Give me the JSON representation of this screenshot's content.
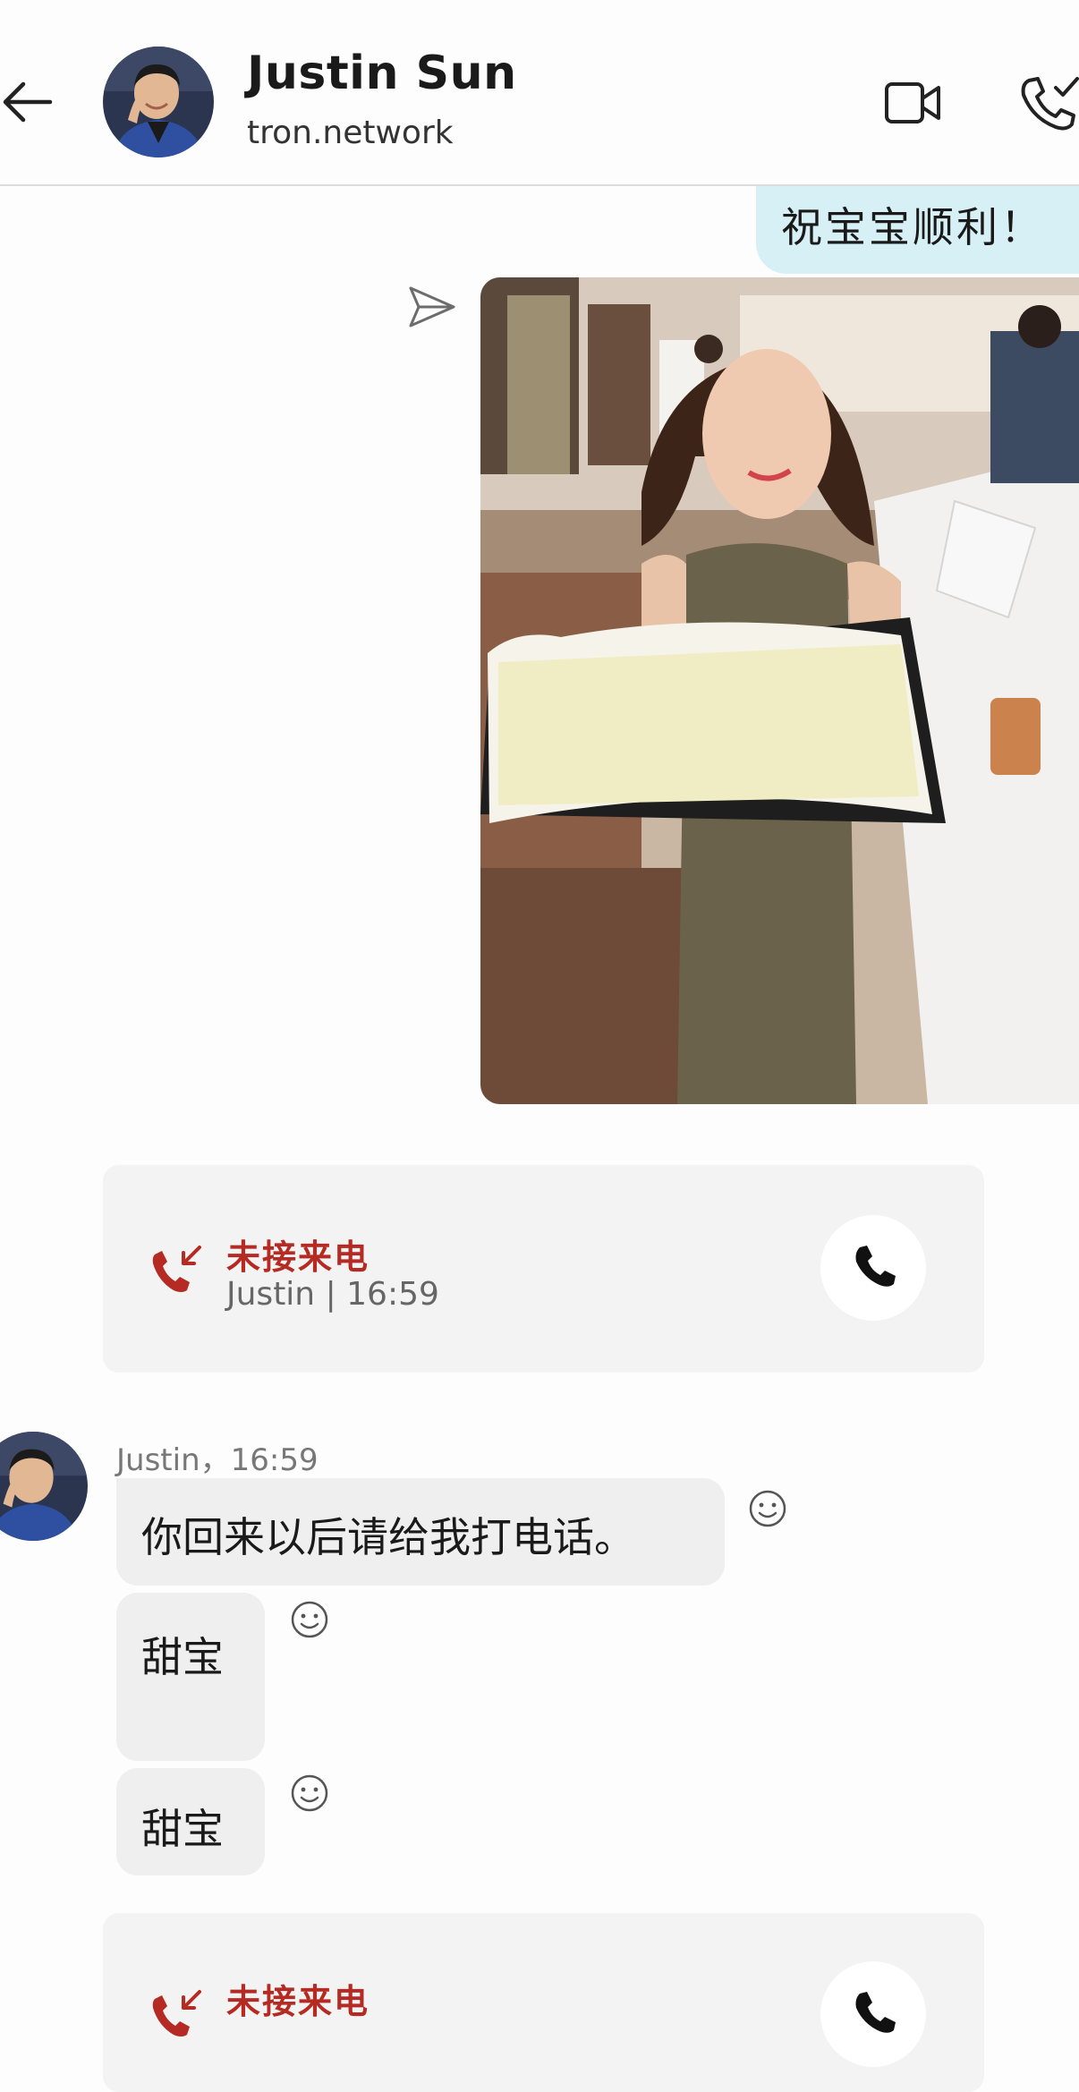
{
  "header": {
    "title": "Justin Sun",
    "subtitle": "tron.network"
  },
  "messages": {
    "sent_text": "祝宝宝顺利！",
    "missed_call_1": {
      "label": "未接来电",
      "detail": "Justin | 16:59"
    },
    "received_meta": "Justin，16:59",
    "received": [
      "你回来以后请给我打电话。",
      "甜宝",
      "甜宝"
    ],
    "missed_call_2": {
      "label": "未接来电"
    }
  },
  "colors": {
    "sent_bubble": "#d6f0f6",
    "received_bubble": "#efefef",
    "missed_call_red": "#b52a22"
  },
  "icons": [
    "back-arrow-icon",
    "video-call-icon",
    "phone-call-icon",
    "send-icon",
    "missed-call-icon",
    "phone-icon",
    "smiley-icon"
  ]
}
